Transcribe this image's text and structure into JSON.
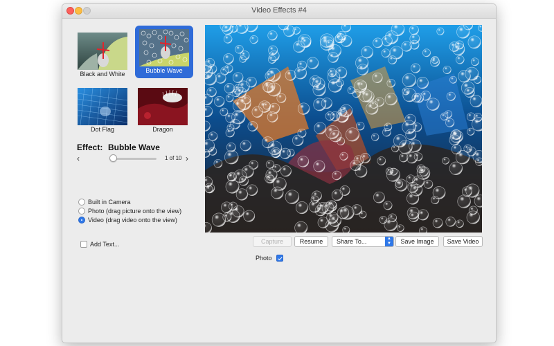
{
  "window": {
    "title": "Video Effects #4"
  },
  "thumbnails": [
    {
      "label": "Black and White",
      "selected": false
    },
    {
      "label": "Bubble Wave",
      "selected": true
    },
    {
      "label": "Dot Flag",
      "selected": false
    },
    {
      "label": "Dragon",
      "selected": false
    }
  ],
  "effect": {
    "label": "Effect:",
    "name": "Bubble Wave",
    "counter": "1 of 10",
    "position": 1,
    "total": 10
  },
  "nav": {
    "prev_icon": "chevron-left-icon",
    "next_icon": "chevron-right-icon"
  },
  "source": {
    "options": [
      {
        "label": "Built in Camera",
        "selected": false
      },
      {
        "label": "Photo (drag picture onto the view)",
        "selected": false
      },
      {
        "label": "Video (drag video onto the view)",
        "selected": true
      }
    ]
  },
  "add_text": {
    "label": "Add Text...",
    "checked": false
  },
  "buttons": {
    "capture": "Capture",
    "resume": "Resume",
    "share_to": "Share To...",
    "save_image": "Save Image",
    "save_video": "Save Video"
  },
  "photo_option": {
    "label": "Photo",
    "checked": true
  },
  "colors": {
    "accent": "#2f78e8",
    "selection": "#2f6bd8",
    "close": "#fc605c",
    "minimize": "#fdbc40"
  }
}
